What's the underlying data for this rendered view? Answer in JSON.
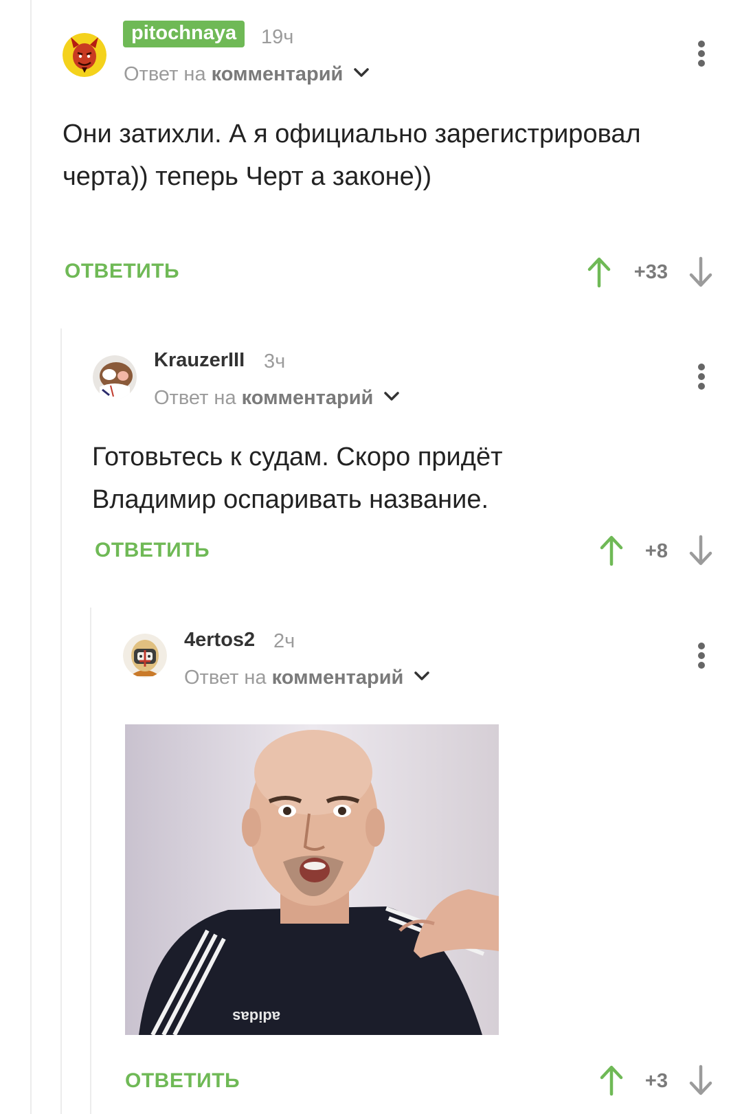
{
  "comments": [
    {
      "author": "pitochnaya",
      "time": "19ч",
      "reply_prefix": "Ответ на",
      "reply_target": "комментарий",
      "text": "Они затихли. А я официально зарегистрировал черта)) теперь Черт а законе))",
      "reply_label": "ОТВЕТИТЬ",
      "rating": "+33",
      "avatar_icon": "devil-avatar-icon"
    },
    {
      "author": "KrauzerIII",
      "time": "3ч",
      "reply_prefix": "Ответ на",
      "reply_target": "комментарий",
      "text": "Готовьтесь к судам. Скоро придёт Владимир оспаривать название.",
      "reply_label": "ОТВЕТИТЬ",
      "rating": "+8",
      "avatar_icon": "cartoon-face-avatar-icon"
    },
    {
      "author": "4ertos2",
      "time": "2ч",
      "reply_prefix": "Ответ на",
      "reply_target": "комментарий",
      "image_caption": "adidas",
      "reply_label": "ОТВЕТИТЬ",
      "rating": "+3",
      "avatar_icon": "robot-helmet-avatar-icon"
    }
  ],
  "colors": {
    "accent": "#6fb956",
    "muted": "#9b9b9b",
    "text": "#222222",
    "thread_line": "#ececec"
  }
}
